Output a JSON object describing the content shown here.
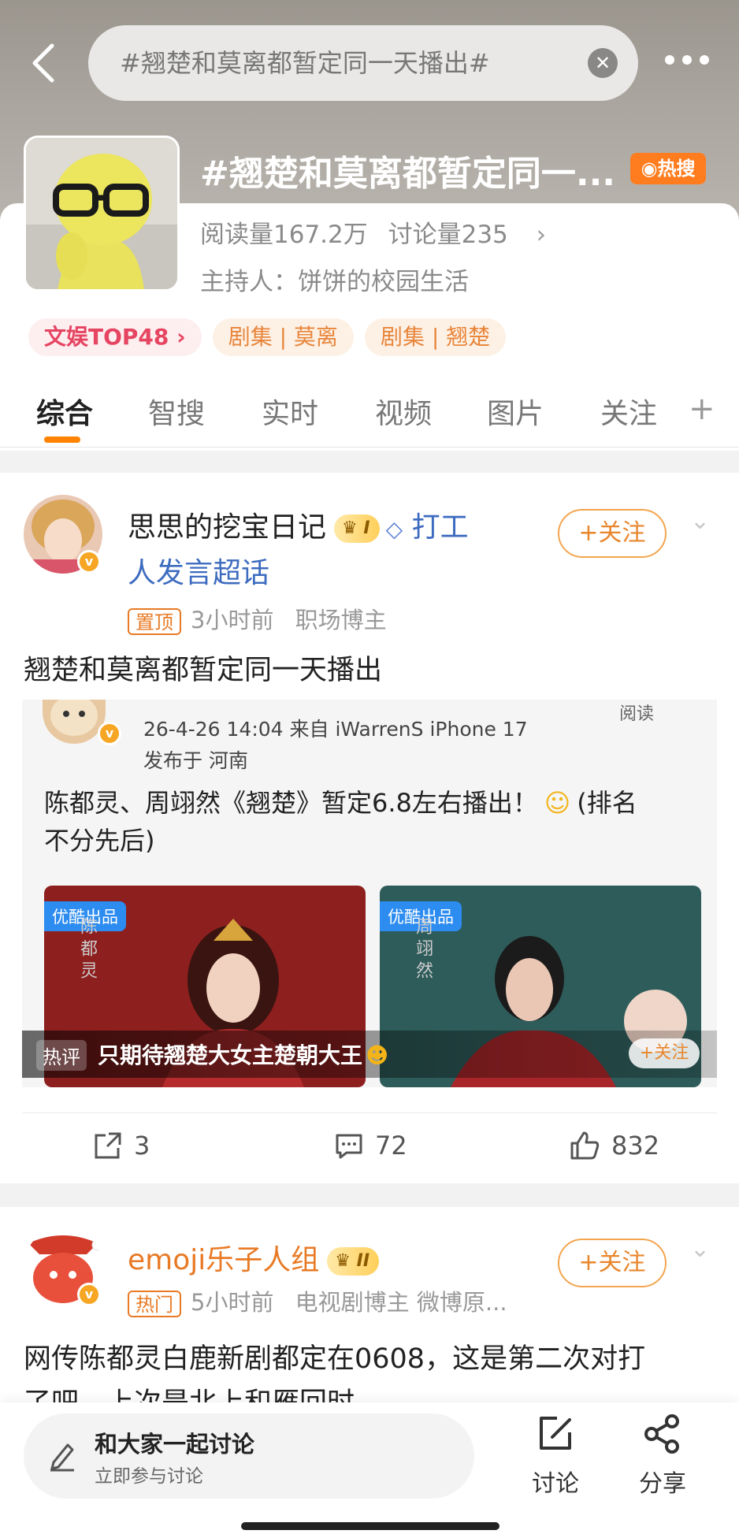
{
  "search": {
    "query": "#翘楚和莫离都暂定同一天播出#"
  },
  "topic": {
    "title": "#翘楚和莫离都暂定同一...",
    "hot_label": "热搜",
    "reads": "阅读量167.2万",
    "discussions": "讨论量235",
    "host": "主持人：饼饼的校园生活",
    "tags": [
      "文娱TOP48 ›",
      "剧集 | 莫离",
      "剧集 | 翘楚"
    ]
  },
  "tabs": [
    "综合",
    "智搜",
    "实时",
    "视频",
    "图片",
    "关注"
  ],
  "posts": [
    {
      "user": "思思的挖宝日记",
      "crown_level": "I",
      "supertalk_line1": "打工",
      "supertalk_line2": "人发言超话",
      "follow": "+关注",
      "badge": "置顶",
      "time": "3小时前",
      "source": "职场博主",
      "text": "翘楚和莫离都暂定同一天播出",
      "quote": {
        "read_label": "阅读",
        "time_device": "26-4-26 14:04  来自 iWarrenS iPhone 17",
        "location": "发布于 河南",
        "text_line1": "陈都灵、周翊然《翘楚》暂定6.8左右播出！",
        "text_line1_tail": "(排名",
        "text_line2": "不分先后)",
        "media_tag": "优酷出品",
        "name_left": "陈都灵",
        "name_right": "周翊然",
        "mini_follow": "+关注",
        "hot_comment_tag": "热评",
        "hot_comment": "只期待翘楚大女主楚朝大王"
      },
      "reposts": "3",
      "comments": "72",
      "likes": "832"
    },
    {
      "user": "emoji乐子人组",
      "crown_level": "II",
      "follow": "+关注",
      "badge": "热门",
      "time": "5小时前",
      "source": "电视剧博主 微博原...",
      "text_line1": "网传陈都灵白鹿新剧都定在0608，这是第二次对打",
      "text_line2": "了吧，上次是北上和雁回时"
    }
  ],
  "bottom": {
    "input_title": "和大家一起讨论",
    "input_sub": "立即参与讨论",
    "discuss": "讨论",
    "share": "分享"
  },
  "colors": {
    "accent": "#ff8200",
    "follow": "#e8862c",
    "rank": "#e64561",
    "link": "#3d6bbf"
  }
}
